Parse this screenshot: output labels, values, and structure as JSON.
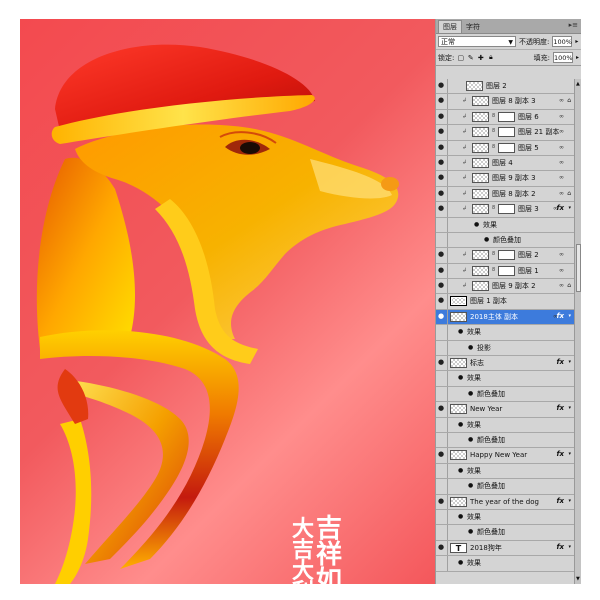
{
  "canvas": {
    "calligraphy_left": "大吉大利",
    "calligraphy_right": "吉祥如"
  },
  "panel": {
    "tabs": [
      {
        "label": "图层",
        "active": true
      },
      {
        "label": "字符",
        "active": false
      }
    ],
    "menu_icon": "panel-menu-icon",
    "blend_mode": "正常",
    "opacity_label": "不透明度:",
    "opacity_value": "100%",
    "lock_label": "锁定:",
    "fill_label": "填充:",
    "fill_value": "100%"
  },
  "layers": [
    {
      "name": "图层 2",
      "type": "layer",
      "indent": 1
    },
    {
      "name": "图层 8 副本 3",
      "type": "layer",
      "indent": 1,
      "clip": true,
      "lock": true,
      "style": true
    },
    {
      "name": "图层 6",
      "type": "masked",
      "indent": 1,
      "clip": true,
      "style": true
    },
    {
      "name": "图层 21 副本",
      "type": "masked",
      "indent": 1,
      "clip": true,
      "style": true
    },
    {
      "name": "图层 5",
      "type": "masked",
      "indent": 1,
      "clip": true,
      "style": true
    },
    {
      "name": "图层 4",
      "type": "layer",
      "indent": 1,
      "clip": true,
      "style": true
    },
    {
      "name": "图层 9 副本 3",
      "type": "layer",
      "indent": 1,
      "clip": true,
      "style": true
    },
    {
      "name": "图层 8 副本 2",
      "type": "layer",
      "indent": 1,
      "clip": true,
      "lock": true,
      "style": true
    },
    {
      "name": "图层 3",
      "type": "masked",
      "indent": 1,
      "clip": true,
      "fx": true,
      "style": true
    },
    {
      "name": "效果",
      "type": "effects",
      "indent": 2
    },
    {
      "name": "颜色叠加",
      "type": "effect",
      "indent": 2
    },
    {
      "name": "图层 2",
      "type": "masked",
      "indent": 1,
      "clip": true,
      "style": true
    },
    {
      "name": "图层 1",
      "type": "masked",
      "indent": 1,
      "clip": true,
      "style": true
    },
    {
      "name": "图层 9 副本 2",
      "type": "layer",
      "indent": 1,
      "clip": true,
      "lock": true,
      "style": true
    },
    {
      "name": "图层 1 副本",
      "type": "layer",
      "indent": 0,
      "highlight": true
    },
    {
      "name": "2018主体 副本",
      "type": "layer",
      "indent": 0,
      "selected": true,
      "fx": true,
      "style": true
    },
    {
      "name": "效果",
      "type": "effects",
      "indent": 0
    },
    {
      "name": "投影",
      "type": "effect",
      "indent": 0
    },
    {
      "name": "标志",
      "type": "layer",
      "indent": 0,
      "fx": true
    },
    {
      "name": "效果",
      "type": "effects",
      "indent": 0
    },
    {
      "name": "颜色叠加",
      "type": "effect",
      "indent": 0
    },
    {
      "name": "New Year",
      "type": "layer",
      "indent": 0,
      "fx": true
    },
    {
      "name": "效果",
      "type": "effects",
      "indent": 0
    },
    {
      "name": "颜色叠加",
      "type": "effect",
      "indent": 0
    },
    {
      "name": "Happy New Year",
      "type": "layer",
      "indent": 0,
      "fx": true
    },
    {
      "name": "效果",
      "type": "effects",
      "indent": 0
    },
    {
      "name": "颜色叠加",
      "type": "effect",
      "indent": 0
    },
    {
      "name": "The year of the dog",
      "type": "layer",
      "indent": 0,
      "fx": true
    },
    {
      "name": "效果",
      "type": "effects",
      "indent": 0
    },
    {
      "name": "颜色叠加",
      "type": "effect",
      "indent": 0
    },
    {
      "name": "2018狗年",
      "type": "text",
      "indent": 0,
      "fx": true
    },
    {
      "name": "效果",
      "type": "effects",
      "indent": 0
    }
  ],
  "colors": {
    "canvas_bg": "#f34a4f",
    "selection": "#3d7bdc",
    "panel_bg": "#d4d4d4"
  }
}
